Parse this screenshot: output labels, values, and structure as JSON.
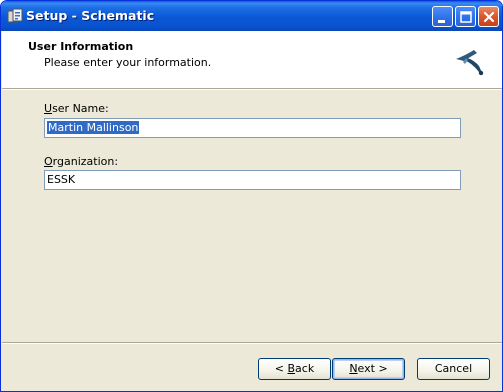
{
  "window": {
    "title": "Setup - Schematic"
  },
  "header": {
    "title": "User Information",
    "subtitle": "Please enter your information."
  },
  "form": {
    "user_name": {
      "label_accel": "U",
      "label_rest": "ser Name:",
      "value": "Martin Mallinson",
      "selected": true
    },
    "organization": {
      "label_accel": "O",
      "label_rest": "rganization:",
      "value": "ESSK"
    }
  },
  "buttons": {
    "back": {
      "prefix": "< ",
      "accel": "B",
      "rest": "ack"
    },
    "next": {
      "accel": "N",
      "rest": "ext >"
    },
    "cancel": {
      "label": "Cancel"
    }
  },
  "icons": {
    "app": "setup-app-icon",
    "logo": "schematic-logo-icon",
    "minimize": "minimize-icon",
    "maximize": "maximize-icon",
    "close": "close-icon"
  },
  "colors": {
    "titlebar": "#0a58d6",
    "selection": "#316ac5",
    "dialog_bg": "#ece9d8"
  }
}
